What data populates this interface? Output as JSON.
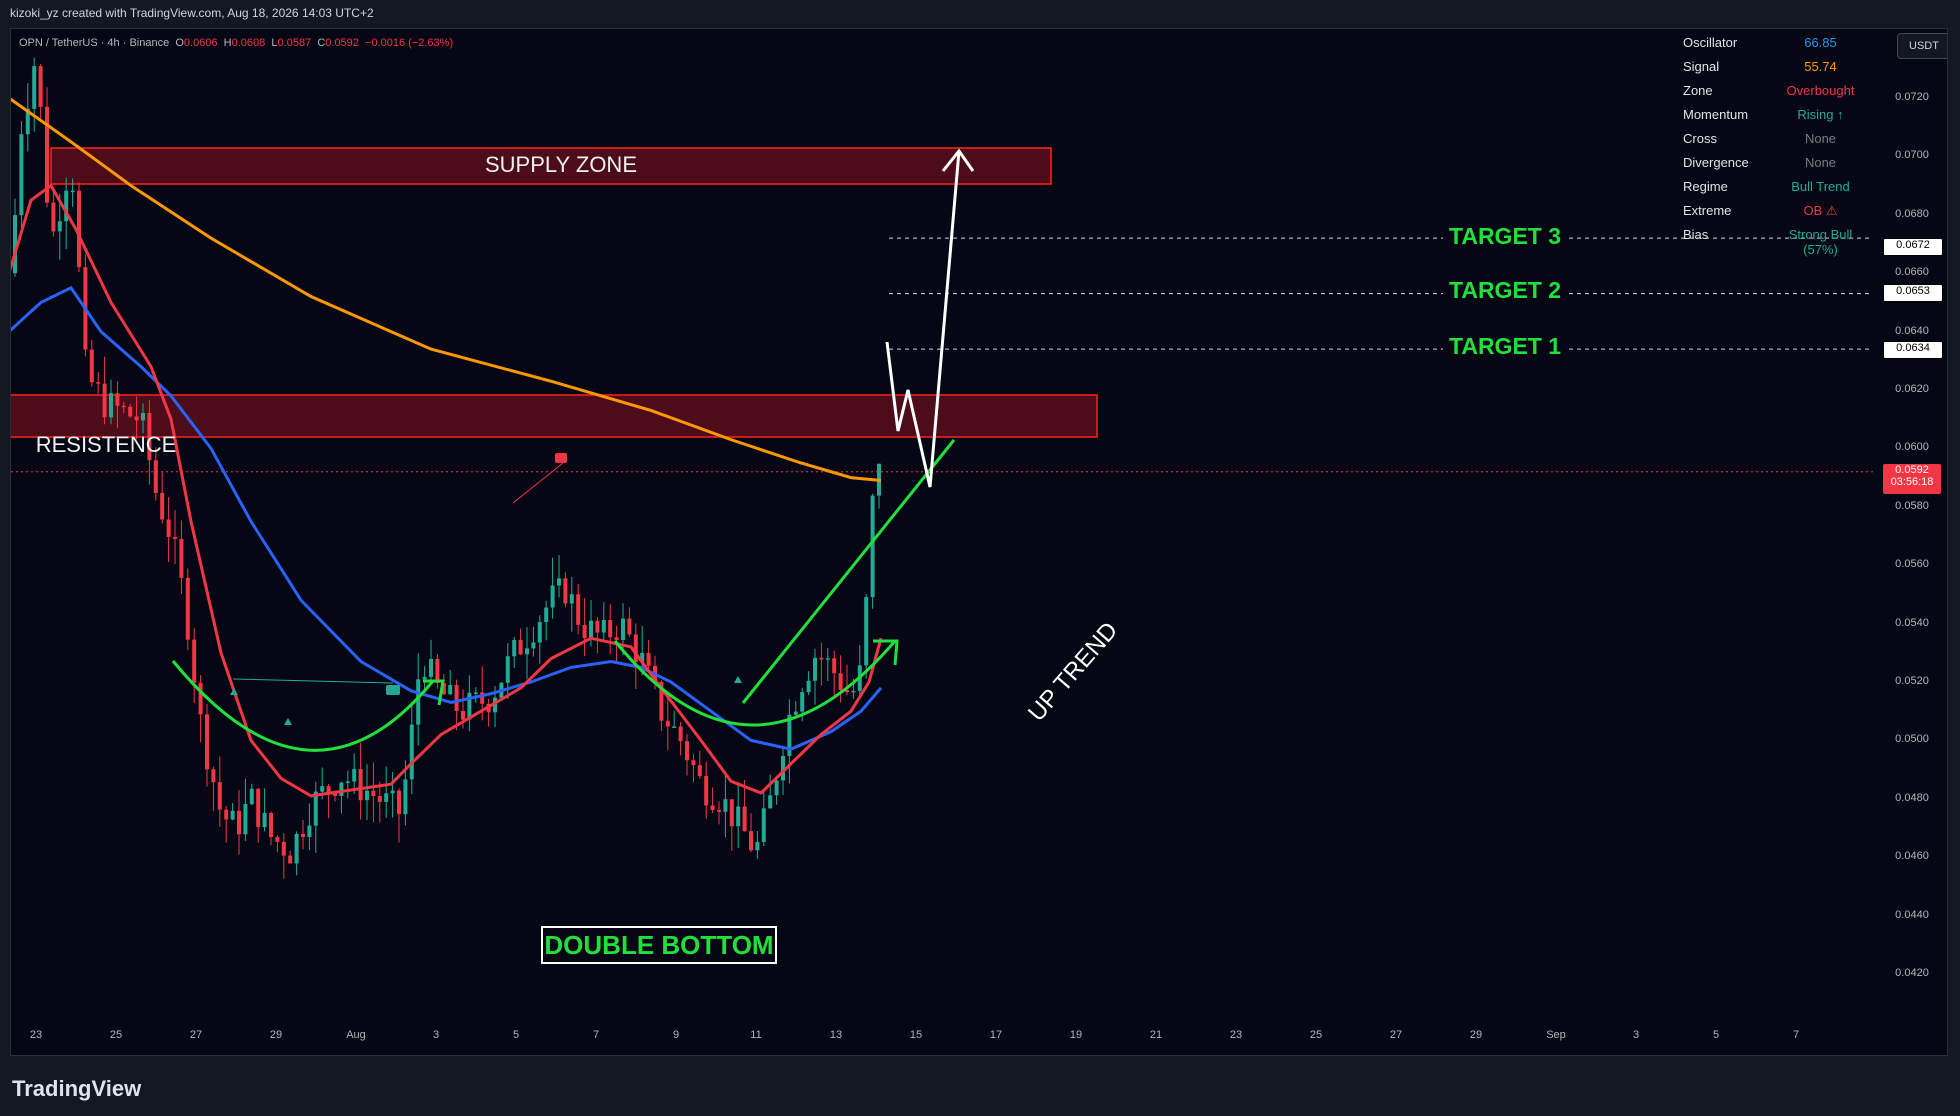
{
  "header": {
    "credit": "kizoki_yz created with TradingView.com, Aug 18, 2026 14:03 UTC+2"
  },
  "legend": {
    "symbol": "OPN / TetherUS · 4h · Binance",
    "o_label": "O",
    "o_value": "0.0606",
    "h_label": "H",
    "h_value": "0.0608",
    "l_label": "L",
    "l_value": "0.0587",
    "c_label": "C",
    "c_value": "0.0592",
    "change": "−0.0016 (−2.63%)"
  },
  "currency_button": "USDT",
  "indicator_panel": [
    {
      "label": "Oscillator",
      "value": "66.85",
      "color": "#2196f3"
    },
    {
      "label": "Signal",
      "value": "55.74",
      "color": "#ff9800"
    },
    {
      "label": "Zone",
      "value": "Overbought",
      "color": "#f23645"
    },
    {
      "label": "Momentum",
      "value": "Rising ↑",
      "color": "#22ab94"
    },
    {
      "label": "Cross",
      "value": "None",
      "color": "#787b86"
    },
    {
      "label": "Divergence",
      "value": "None",
      "color": "#787b86"
    },
    {
      "label": "Regime",
      "value": "Bull Trend",
      "color": "#22ab94"
    },
    {
      "label": "Extreme",
      "value": "OB ⚠",
      "color": "#f23645"
    },
    {
      "label": "Bias",
      "value": "Strong Bull (57%)",
      "color": "#22ab94"
    }
  ],
  "annotations": {
    "supply_zone": "SUPPLY ZONE",
    "resistance": "RESISTENCE",
    "target1": "TARGET 1",
    "target2": "TARGET 2",
    "target3": "TARGET 3",
    "double_bottom": "DOUBLE BOTTOM",
    "up_trend": "UP TREND"
  },
  "price_axis": {
    "ticks": [
      "0.0720",
      "0.0700",
      "0.0680",
      "0.0660",
      "0.0640",
      "0.0620",
      "0.0600",
      "0.0580",
      "0.0560",
      "0.0540",
      "0.0520",
      "0.0500",
      "0.0480",
      "0.0460",
      "0.0440",
      "0.0420"
    ],
    "target_labels": [
      "0.0672",
      "0.0653",
      "0.0634"
    ],
    "current_price": "0.0592",
    "countdown": "03:56:18"
  },
  "time_axis": {
    "ticks": [
      "23",
      "25",
      "27",
      "29",
      "Aug",
      "3",
      "5",
      "7",
      "9",
      "11",
      "13",
      "15",
      "17",
      "19",
      "21",
      "23",
      "25",
      "27",
      "29",
      "Sep",
      "3",
      "5",
      "7"
    ]
  },
  "footer": {
    "brand": "TradingView"
  },
  "colors": {
    "bull": "#22ab94",
    "bear": "#f23645",
    "ema_fast": "#f23645",
    "ema_slow": "#2962ff",
    "ema_long": "#ff9800",
    "annotation_green": "#22e03c"
  }
}
